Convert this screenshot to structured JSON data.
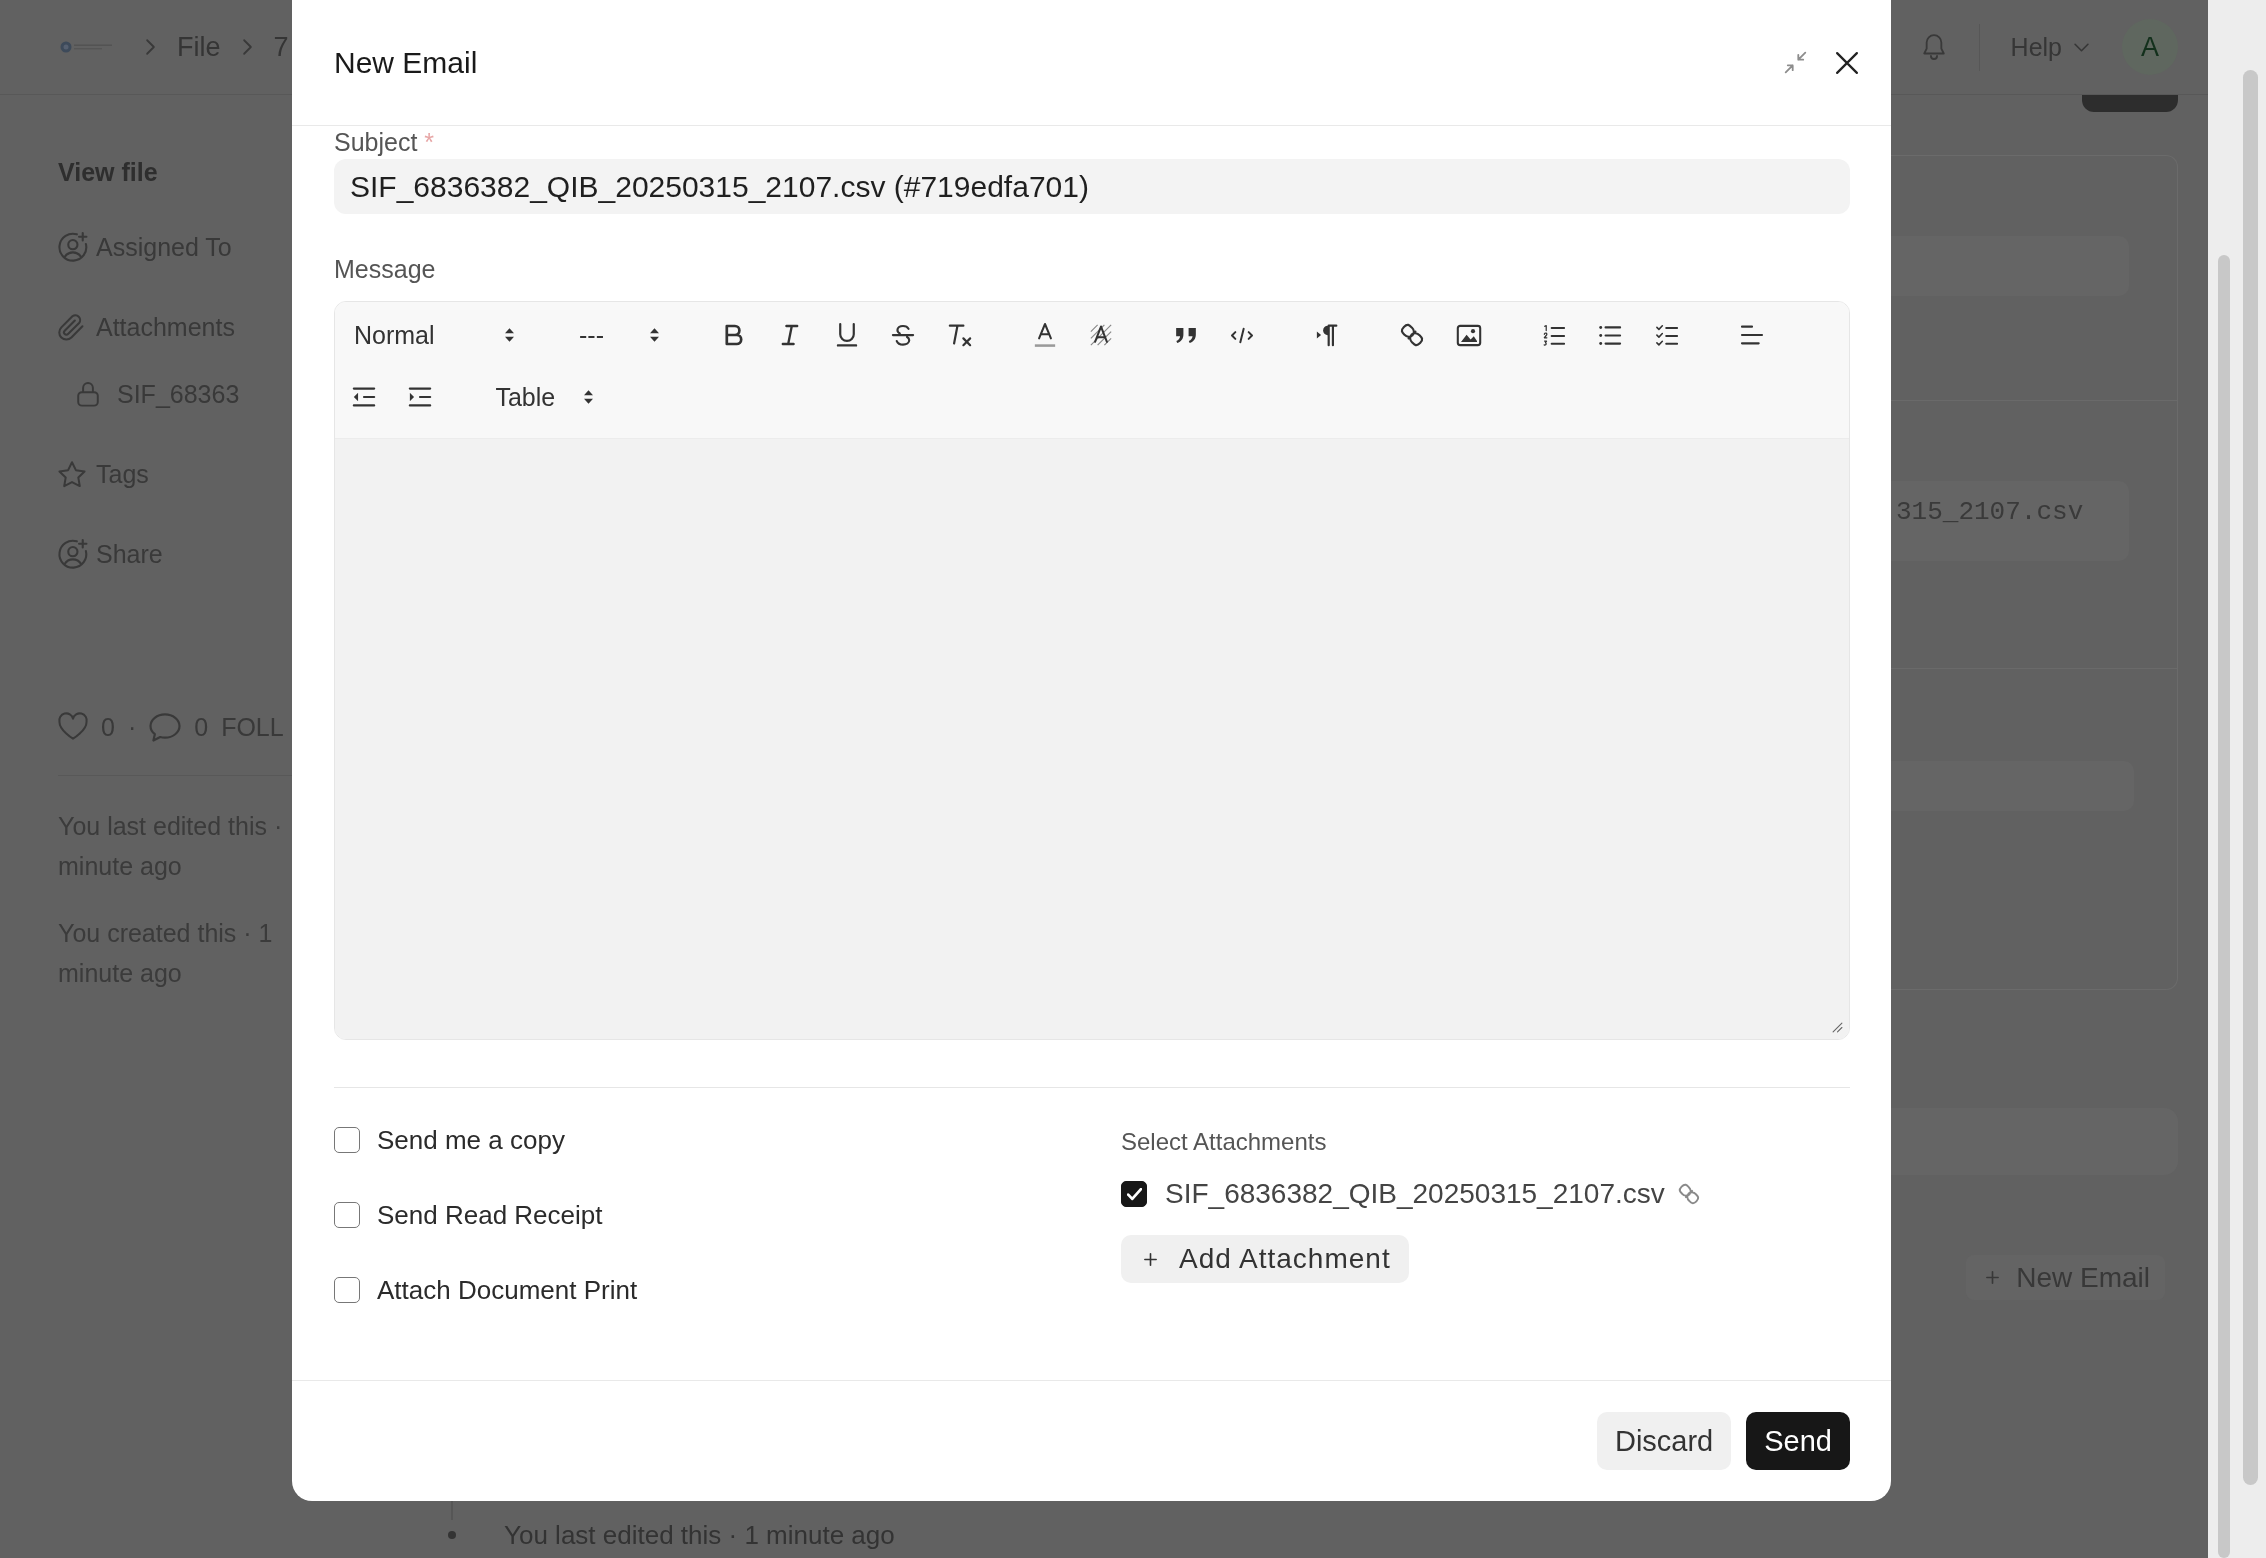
{
  "background_page": {
    "breadcrumbs": [
      "File",
      "7"
    ],
    "help_menu": "Help",
    "avatar": "A",
    "sidebar": {
      "title": "View file",
      "items": [
        {
          "kind": "assign",
          "label": "Assigned To"
        },
        {
          "kind": "attachments",
          "label": "Attachments"
        },
        {
          "kind": "file",
          "label": "SIF_68363"
        },
        {
          "kind": "tags",
          "label": "Tags"
        },
        {
          "kind": "share",
          "label": "Share"
        }
      ],
      "stats": {
        "likes": "0",
        "separator": "·",
        "comments": "0",
        "follow": "FOLL"
      },
      "activity": [
        {
          "lines": [
            "You last edited this ·",
            "minute ago"
          ]
        },
        {
          "lines": [
            "You created this · 1",
            "minute ago"
          ]
        }
      ]
    },
    "content": {
      "field_value": "315_2107.csv",
      "new_email_button": "New Email",
      "timeline": [
        {
          "text": "You last edited this · 1 minute ago"
        }
      ]
    }
  },
  "dialog": {
    "title": "New Email",
    "subject": {
      "label": "Subject",
      "required_mark": "*",
      "value": "SIF_6836382_QIB_20250315_2107.csv (#719edfa701)"
    },
    "message": {
      "label": "Message",
      "toolbar": {
        "selects": [
          {
            "value": "Normal"
          },
          {
            "value": "---"
          },
          {
            "value": "Table"
          }
        ]
      }
    },
    "options": [
      {
        "label": "Send me a copy",
        "checked": false
      },
      {
        "label": "Send Read Receipt",
        "checked": false
      },
      {
        "label": "Attach Document Print",
        "checked": false
      }
    ],
    "attachments": {
      "label": "Select Attachments",
      "items": [
        {
          "name": "SIF_6836382_QIB_20250315_2107.csv",
          "checked": true
        }
      ],
      "add_button": "Add Attachment"
    },
    "buttons": [
      {
        "label": "Discard",
        "kind": "secondary"
      },
      {
        "label": "Send",
        "kind": "primary"
      }
    ]
  }
}
